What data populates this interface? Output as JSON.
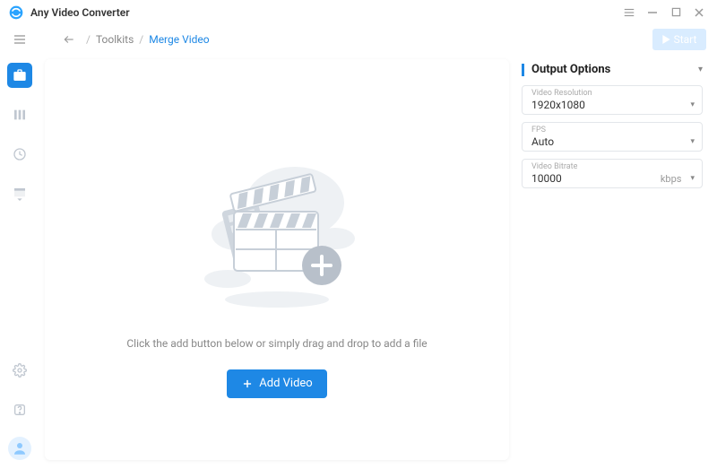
{
  "app": {
    "title": "Any Video Converter"
  },
  "toolbar": {
    "breadcrumb_parent": "Toolkits",
    "breadcrumb_current": "Merge Video",
    "start_label": "Start"
  },
  "main": {
    "hint": "Click the add button below or simply drag and drop to add a file",
    "add_video_label": "Add Video"
  },
  "options": {
    "header": "Output Options",
    "resolution": {
      "label": "Video Resolution",
      "value": "1920x1080"
    },
    "fps": {
      "label": "FPS",
      "value": "Auto"
    },
    "bitrate": {
      "label": "Video Bitrate",
      "value": "10000",
      "unit": "kbps"
    }
  }
}
